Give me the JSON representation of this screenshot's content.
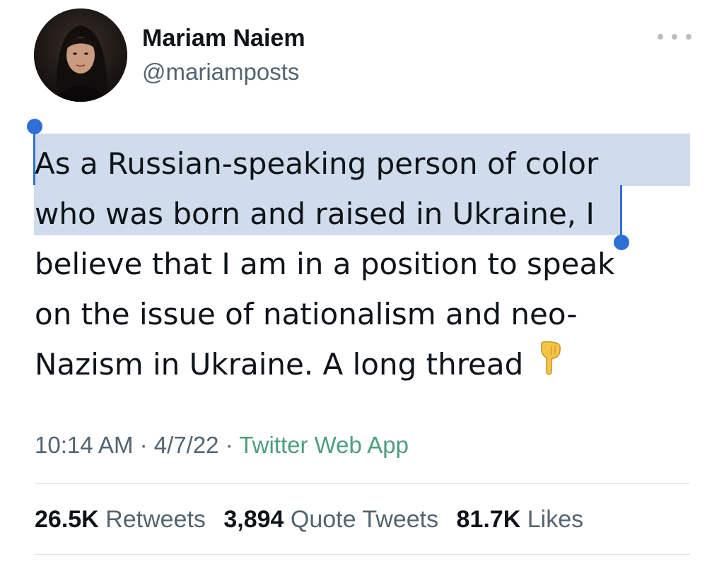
{
  "author": {
    "name": "Mariam Naiem",
    "handle": "@mariamposts"
  },
  "tweet": {
    "lines": [
      "As a Russian-speaking person of color",
      "who was born and raised in Ukraine, I",
      "believe that I am in a position to speak",
      "on the issue of nationalism and neo-",
      "Nazism in Ukraine. A long thread"
    ],
    "emoji": "backhand-index-pointing-down",
    "selected_text": "As a Russian-speaking person of color who was born and raised in Ukraine"
  },
  "meta": {
    "time": "10:14 AM",
    "separator": "·",
    "date": "4/7/22",
    "source": "Twitter Web App"
  },
  "stats": {
    "retweets_count": "26.5K",
    "retweets_label": "Retweets",
    "quotes_count": "3,894",
    "quotes_label": "Quote Tweets",
    "likes_count": "81.7K",
    "likes_label": "Likes"
  },
  "colors": {
    "selection": "#d0dcec",
    "selection_handle": "#2f6fd8",
    "source_link": "#4d9e7a",
    "secondary_text": "#536471"
  }
}
